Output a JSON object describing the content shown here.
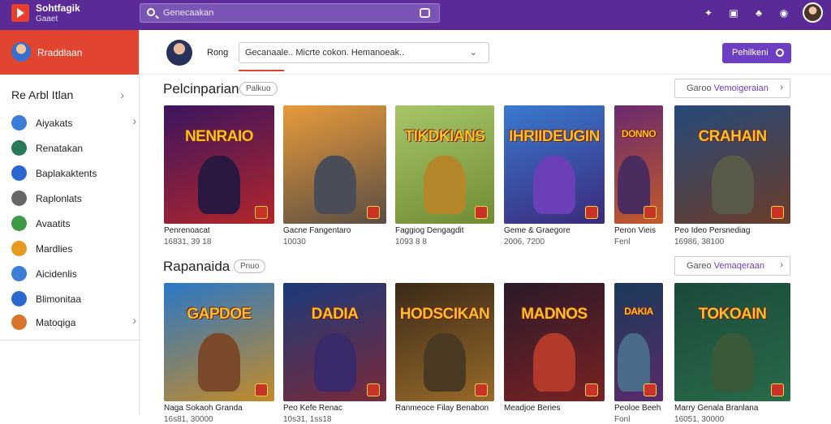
{
  "app": {
    "name": "Sohtfagik",
    "sub": "Gaaet"
  },
  "search": {
    "placeholder": "Genecaakan"
  },
  "sidebar": {
    "top_label": "Rraddlaan",
    "section_label": "Re Arbl Itlan",
    "items": [
      {
        "label": "Aiyakats",
        "icon": "globe-icon",
        "color": "#3b7dd8",
        "chevron": true
      },
      {
        "label": "Renatakan",
        "icon": "gamepad-icon",
        "color": "#2a7a5a",
        "chevron": false
      },
      {
        "label": "Baplakaktents",
        "icon": "store-icon",
        "color": "#2b67d1",
        "chevron": false
      },
      {
        "label": "Raplonlats",
        "icon": "document-icon",
        "color": "#666666",
        "chevron": false
      },
      {
        "label": "Avaatits",
        "icon": "people-icon",
        "color": "#3d9a45",
        "chevron": false
      },
      {
        "label": "Mardlies",
        "icon": "medal-icon",
        "color": "#e69a1f",
        "chevron": false
      },
      {
        "label": "Aicidenlis",
        "icon": "social-icon",
        "color": "#3b7dd8",
        "chevron": false
      },
      {
        "label": "Blimonitaa",
        "icon": "chart-icon",
        "color": "#2b67d1",
        "chevron": false
      },
      {
        "label": "Matoqiga",
        "icon": "gift-icon",
        "color": "#d9742a",
        "chevron": true
      }
    ]
  },
  "header": {
    "user_name": "Rong",
    "select_text": "Gecanaale..  Micrte cokon.  Hemanoeak..",
    "button_label": "Pehilkeni"
  },
  "sections": [
    {
      "title": "Pelcinparian",
      "pill": "Palkuo",
      "view_lead": "Garoo",
      "view_link": "Vemoigeraian",
      "cards": [
        {
          "art_title": "NENRAIO",
          "name": "Penrenoacat",
          "meta": "16831, 39 18",
          "c1": "#3b1560",
          "c2": "#b4262a",
          "fig": "#2a1840"
        },
        {
          "art_title": "",
          "name": "Gacne Fangentaro",
          "meta": "10030",
          "c1": "#e89a3a",
          "c2": "#5a4e44",
          "fig": "#4a4d58"
        },
        {
          "art_title": "TIKDKIANS",
          "name": "Faggiog Dengagdit",
          "meta": "1093 8 8",
          "c1": "#a7c568",
          "c2": "#6f8c34",
          "fig": "#b5872b"
        },
        {
          "art_title": "IHRIIDEUGIN",
          "name": "Geme & Graegore",
          "meta": "2006, 7200",
          "c1": "#3a7ad0",
          "c2": "#3b2a7a",
          "fig": "#6b3fb8"
        },
        {
          "art_title": "DONNO",
          "name": "Peron Vieis",
          "meta": "Fenl",
          "c1": "#6a2a6e",
          "c2": "#c45a2a",
          "fig": "#4b2c5e"
        },
        {
          "art_title": "CRAHAIN",
          "name": "Peo Ideo Persnediag",
          "meta": "16986, 38100",
          "c1": "#274a7a",
          "c2": "#6a3d2a",
          "fig": "#5a5a48"
        }
      ]
    },
    {
      "title": "Rapanaida",
      "pill": "Pnuo",
      "view_lead": "Gareo",
      "view_link": "Vemaqeraan",
      "cards": [
        {
          "art_title": "GAPDOE",
          "name": "Naga Sokaoh Granda",
          "meta": "16s81, 30000",
          "c1": "#2a78c8",
          "c2": "#c48a28",
          "fig": "#7a4a2a"
        },
        {
          "art_title": "DADIA",
          "name": "Peo Kefe Renac",
          "meta": "10s31, 1ss18",
          "c1": "#1c3a7a",
          "c2": "#7a2a3a",
          "fig": "#3a2a6a"
        },
        {
          "art_title": "HODSCIKAN",
          "name": "Ranmeoce Filay Benabon",
          "meta": "",
          "c1": "#3a2a18",
          "c2": "#9a6a2a",
          "fig": "#4a3a24"
        },
        {
          "art_title": "MADNOS",
          "name": "Meadjoe Beries",
          "meta": "",
          "c1": "#2a1a2a",
          "c2": "#7a2222",
          "fig": "#b23a2a"
        },
        {
          "art_title": "DAKIA",
          "name": "Peoloe Beeh",
          "meta": "Fonl",
          "c1": "#1a3a5a",
          "c2": "#5a2a6a",
          "fig": "#4a6a8a"
        },
        {
          "art_title": "TOKOAIN",
          "name": "Marry Genala Branlana",
          "meta": "16051, 30000",
          "c1": "#1a4a3a",
          "c2": "#2a6a4a",
          "fig": "#3a5a3a"
        }
      ]
    }
  ],
  "topbar_icons": [
    "puzzle-icon",
    "chat-icon",
    "game-controller-icon",
    "settings-icon"
  ]
}
